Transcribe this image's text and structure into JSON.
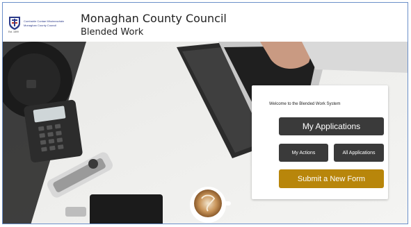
{
  "header": {
    "logo_line1": "Comhairle Contae Mhuineacháin",
    "logo_line2": "Monaghan County Council",
    "logo_line3": "Est. 1899",
    "title": "Monaghan County Council",
    "subtitle": "Blended Work"
  },
  "card": {
    "welcome": "Welcome to the Blended Work System",
    "my_applications": "My Applications",
    "my_actions": "My Actions",
    "all_applications": "All Applications",
    "submit_form": "Submit a New Form"
  },
  "colors": {
    "button_dark": "#3a3a3a",
    "button_gold": "#b8860b",
    "frame_border": "#6b8fc9"
  },
  "icons": {
    "logo": "crest-icon"
  }
}
